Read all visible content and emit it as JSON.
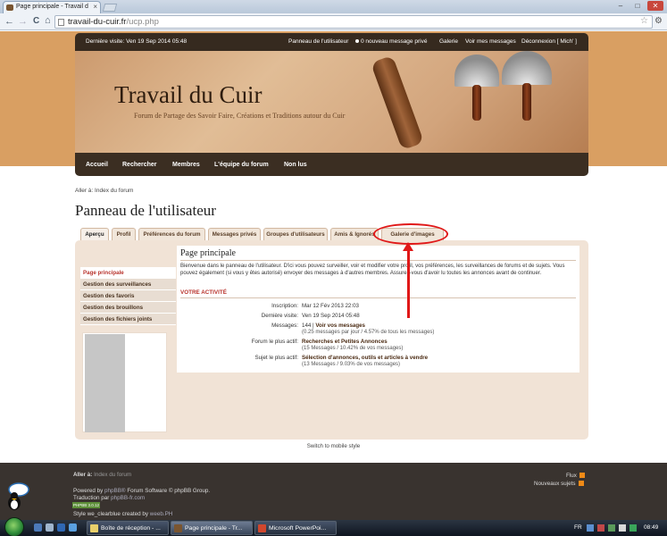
{
  "browser": {
    "tab_title": "Page principale - Travail d",
    "tab_close": "×",
    "url_domain": "travail-du-cuir.fr",
    "url_path": "/ucp.php",
    "nav_back": "←",
    "nav_forward": "→",
    "nav_reload": "C",
    "nav_home": "⌂",
    "window_min": "–",
    "window_max": "□",
    "window_close": "✕",
    "bookmark_star": "☆",
    "wrench": "⚙"
  },
  "forum": {
    "topbar": {
      "last_visit": "Dernière visite: Ven 19 Sep 2014 05:48",
      "user_panel": "Panneau de l'utilisateur",
      "new_pm": "0 nouveau message privé",
      "gallery": "Galerie",
      "my_posts": "Voir mes messages",
      "logout": "Déconnexion [ Mich' ]"
    },
    "site_title": "Travail du Cuir",
    "tagline": "Forum de Partage des Savoir Faire, Créations et Traditions autour du Cuir",
    "nav": [
      "Accueil",
      "Rechercher",
      "Membres",
      "L'équipe du forum",
      "Non lus"
    ],
    "breadcrumb_prefix": "Aller à:",
    "breadcrumb_link": "Index du forum",
    "page_title": "Panneau de l'utilisateur",
    "tabs": [
      "Aperçu",
      "Profil",
      "Préférences du forum",
      "Messages privés",
      "Groupes d'utilisateurs",
      "Amis & Ignorés",
      "Galerie d'images"
    ],
    "active_tab": "Aperçu",
    "side_nav": [
      "Page principale",
      "Gestion des surveillances",
      "Gestion des favoris",
      "Gestion des brouillons",
      "Gestion des fichiers joints"
    ],
    "main": {
      "heading": "Page principale",
      "intro": "Bienvenue dans le panneau de l'utilisateur. D'ici vous pouvez surveiller, voir et modifier votre profil, vos préférences, les surveillances de forums et de sujets. Vous pouvez également (si vous y êtes autorisé) envoyer des messages à d'autres membres. Assurez-vous d'avoir lu toutes les annonces avant de continuer.",
      "activity_title": "VOTRE ACTIVITÉ",
      "registered_label": "Inscription:",
      "registered_value": "Mar 12 Fév 2013 22:03",
      "last_visit_label": "Dernière visite:",
      "last_visit_value": "Ven 19 Sep 2014 05:48",
      "messages_label": "Messages:",
      "messages_count": "144 |",
      "messages_link": "Voir vos messages",
      "messages_sub": "(0.25 messages par jour / 4.57% de tous les messages)",
      "active_forum_label": "Forum le plus actif:",
      "active_forum_value": "Recherches et Petites Annonces",
      "active_forum_sub": "(15 Messages / 10.42% de vos messages)",
      "active_topic_label": "Sujet le plus actif:",
      "active_topic_value": "Sélection d'annonces, outils et articles à vendre",
      "active_topic_sub": "(13 Messages / 9.03% de vos messages)"
    },
    "mobile_switch": "Switch to mobile style",
    "footer": {
      "jump_label": "Aller à:",
      "jump_link": "Index du forum",
      "powered": "Powered by",
      "powered_link": "phpBB®",
      "powered_rest": "Forum Software © phpBB Group.",
      "translation_label": "Traduction par",
      "translation_link": "phpBB-fr.com",
      "badge": "PHPBB 3.0.12",
      "style_label": "Style we_clearblue created by",
      "style_author": "weeb.PH",
      "rss1": "Flux",
      "rss2": "Nouveaux sujets"
    }
  },
  "taskbar": {
    "items": [
      "Boîte de réception - ...",
      "Page principale - Tr...",
      "Microsoft PowerPoi..."
    ],
    "lang": "FR",
    "time": "08:49"
  },
  "colors": {
    "accent_red": "#b8322b",
    "annotation_red": "#e01818",
    "header_brown": "#362a1f",
    "page_bg": "#d99f62"
  }
}
